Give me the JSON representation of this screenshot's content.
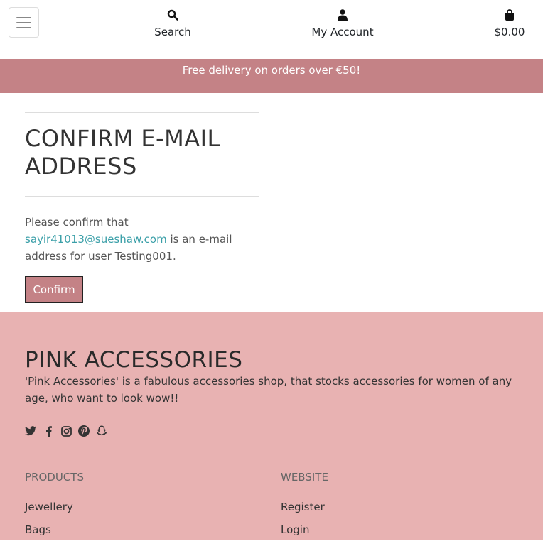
{
  "header": {
    "search_label": "Search",
    "account_label": "My Account",
    "cart_total": "$0.00"
  },
  "banner": {
    "text": "Free delivery on orders over €50!"
  },
  "main": {
    "title": "CONFIRM E-MAIL ADDRESS",
    "text_before": "Please confirm that",
    "email": "sayir41013@sueshaw.com",
    "text_after": "is an e-mail address for user Testing001.",
    "confirm_label": "Confirm"
  },
  "footer": {
    "brand": "PINK ACCESSORIES",
    "description": "'Pink Accessories' is a fabulous accessories shop, that stocks accessories for women of any age, who want to look wow!!",
    "social_icons": [
      "twitter-icon",
      "facebook-icon",
      "instagram-icon",
      "pinterest-icon",
      "snapchat-icon"
    ],
    "products": {
      "heading": "PRODUCTS",
      "links": [
        "Jewellery",
        "Bags"
      ]
    },
    "website": {
      "heading": "WEBSITE",
      "links": [
        "Register",
        "Login"
      ]
    }
  },
  "colors": {
    "accent": "#c48286",
    "footer_bg": "#e8b2b2",
    "link": "#3a9fa8"
  }
}
